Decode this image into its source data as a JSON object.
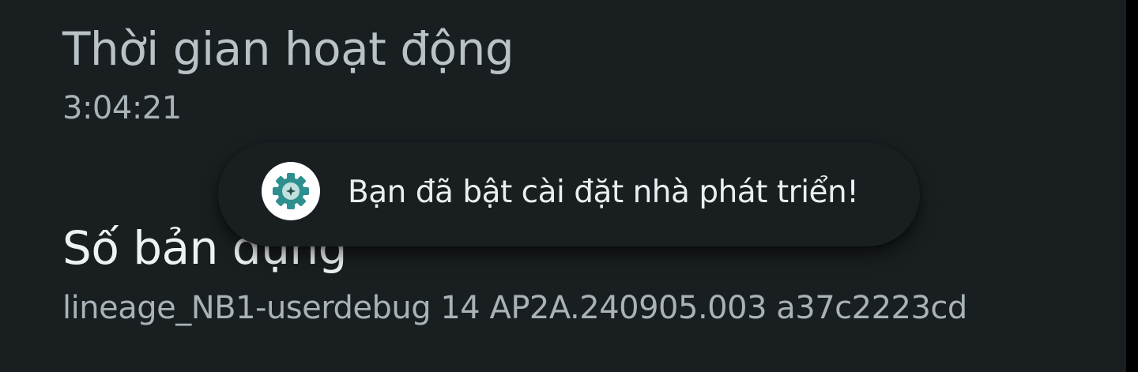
{
  "items": [
    {
      "title": "Thời gian hoạt động",
      "summary": "3:04:21"
    },
    {
      "title": "Số bản dựng",
      "summary": "lineage_NB1-userdebug 14 AP2A.240905.003 a37c2223cd"
    }
  ],
  "toast": {
    "icon": "settings-gear-icon",
    "message": "Bạn đã bật cài đặt nhà phát triển!"
  },
  "colors": {
    "background": "#191e21",
    "icon_accent": "#2f8f8f"
  }
}
